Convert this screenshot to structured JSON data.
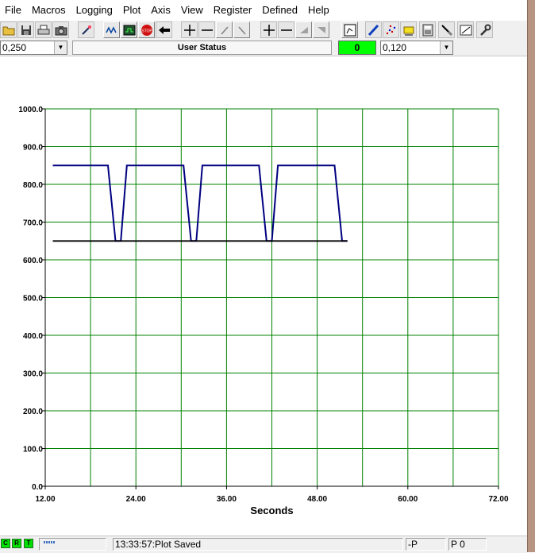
{
  "menu": [
    "File",
    "Macros",
    "Logging",
    "Plot",
    "Axis",
    "View",
    "Register",
    "Defined",
    "Help"
  ],
  "toolbar_icons": [
    "open-icon",
    "save-icon",
    "print-icon",
    "camera-icon",
    "wand-icon",
    "scope-icon",
    "display-icon",
    "stop-icon",
    "back-arrow-icon",
    "zoom-in-icon",
    "zoom-out-icon",
    "pan-left-icon",
    "pan-right-icon",
    "y-zoom-in-icon",
    "y-zoom-out-icon",
    "y-pan-up-icon",
    "y-pan-down-icon",
    "plot-window-icon",
    "pen-icon",
    "points-icon",
    "highlight-icon",
    "calculator-icon",
    "probe-icon",
    "scale-icon",
    "wrench-icon"
  ],
  "stop_label": "STOP",
  "status": {
    "left_combo": "0,250",
    "user_status": "User Status",
    "counter": "0",
    "right_combo": "0,120"
  },
  "colors": {
    "grid": "#008000",
    "series": "#000080",
    "baseline": "#000000",
    "counter_bg": "#00ff00"
  },
  "chart_data": {
    "type": "line",
    "xlabel": "Seconds",
    "ylabel": "",
    "xlim": [
      12,
      72
    ],
    "ylim": [
      0,
      1000
    ],
    "xticks": [
      "12.00",
      "24.00",
      "36.00",
      "48.00",
      "60.00",
      "72.00"
    ],
    "yticks": [
      "0.0",
      "100.0",
      "200.0",
      "300.0",
      "400.0",
      "500.0",
      "600.0",
      "700.0",
      "800.0",
      "900.0",
      "1000.0"
    ],
    "x_divisions": 10,
    "y_divisions": 10,
    "grid": true,
    "series": [
      {
        "x": [
          13.0,
          20.3,
          21.3,
          22.0,
          22.8,
          30.3,
          31.3,
          32.0,
          32.8,
          40.3,
          41.3,
          42.0,
          42.8,
          50.3,
          51.3,
          52.0
        ],
        "values": [
          850,
          850,
          650,
          650,
          850,
          850,
          650,
          650,
          850,
          850,
          650,
          650,
          850,
          850,
          650,
          650
        ]
      },
      {
        "x": [
          13.0,
          52.0
        ],
        "values": [
          650,
          650
        ]
      }
    ]
  },
  "statusbar": {
    "leds": [
      "C",
      "R",
      "T"
    ],
    "message": "13:33:57:Plot Saved",
    "mode": "-P",
    "page": "P 0"
  }
}
